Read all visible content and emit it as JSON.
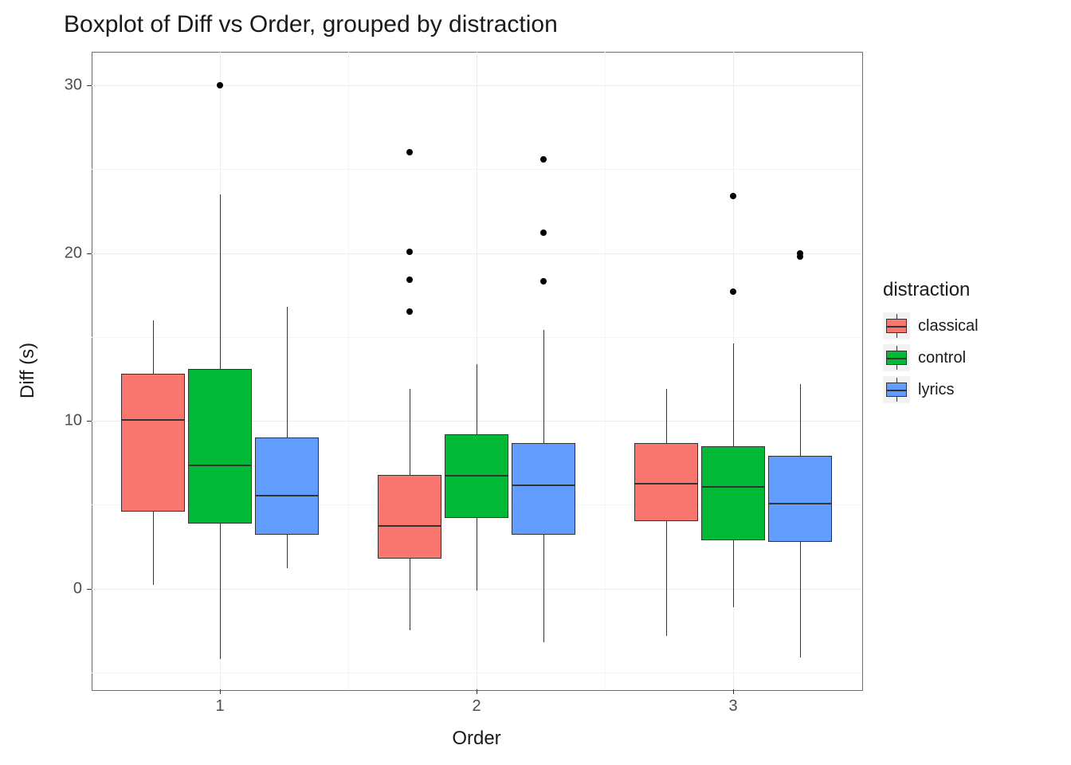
{
  "title": "Boxplot of Diff vs Order, grouped by distraction",
  "xlabel": "Order",
  "ylabel": "Diff (s)",
  "legend_title": "distraction",
  "legend_items": [
    {
      "label": "classical",
      "color": "#F8766D"
    },
    {
      "label": "control",
      "color": "#00BA38"
    },
    {
      "label": "lyrics",
      "color": "#619CFF"
    }
  ],
  "y_ticks": [
    0,
    10,
    20,
    30
  ],
  "x_ticks": [
    "1",
    "2",
    "3"
  ],
  "chart_data": {
    "type": "box",
    "xlabel": "Order",
    "ylabel": "Diff (s)",
    "ylim": [
      -6,
      32
    ],
    "categories": [
      "1",
      "2",
      "3"
    ],
    "group_var": "distraction",
    "groups": [
      "classical",
      "control",
      "lyrics"
    ],
    "colors": {
      "classical": "#F8766D",
      "control": "#00BA38",
      "lyrics": "#619CFF"
    },
    "boxes": [
      {
        "order": "1",
        "group": "classical",
        "ymin": 0.2,
        "q1": 4.6,
        "median": 10.1,
        "q3": 12.8,
        "ymax": 16.0,
        "outliers": []
      },
      {
        "order": "1",
        "group": "control",
        "ymin": -4.2,
        "q1": 3.9,
        "median": 7.4,
        "q3": 13.1,
        "ymax": 23.5,
        "outliers": [
          30.0
        ]
      },
      {
        "order": "1",
        "group": "lyrics",
        "ymin": 1.2,
        "q1": 3.2,
        "median": 5.6,
        "q3": 9.0,
        "ymax": 16.8,
        "outliers": []
      },
      {
        "order": "2",
        "group": "classical",
        "ymin": -2.5,
        "q1": 1.8,
        "median": 3.8,
        "q3": 6.8,
        "ymax": 11.9,
        "outliers": [
          16.5,
          18.4,
          20.1,
          26.0
        ]
      },
      {
        "order": "2",
        "group": "control",
        "ymin": -0.1,
        "q1": 4.2,
        "median": 6.8,
        "q3": 9.2,
        "ymax": 13.4,
        "outliers": []
      },
      {
        "order": "2",
        "group": "lyrics",
        "ymin": -3.2,
        "q1": 3.2,
        "median": 6.2,
        "q3": 8.7,
        "ymax": 15.4,
        "outliers": [
          18.3,
          21.2,
          25.6
        ]
      },
      {
        "order": "3",
        "group": "classical",
        "ymin": -2.8,
        "q1": 4.0,
        "median": 6.3,
        "q3": 8.7,
        "ymax": 11.9,
        "outliers": []
      },
      {
        "order": "3",
        "group": "control",
        "ymin": -1.1,
        "q1": 2.9,
        "median": 6.1,
        "q3": 8.5,
        "ymax": 14.6,
        "outliers": [
          17.7,
          23.4
        ]
      },
      {
        "order": "3",
        "group": "lyrics",
        "ymin": -4.1,
        "q1": 2.8,
        "median": 5.1,
        "q3": 7.9,
        "ymax": 12.2,
        "outliers": [
          19.8,
          20.0
        ]
      }
    ]
  }
}
